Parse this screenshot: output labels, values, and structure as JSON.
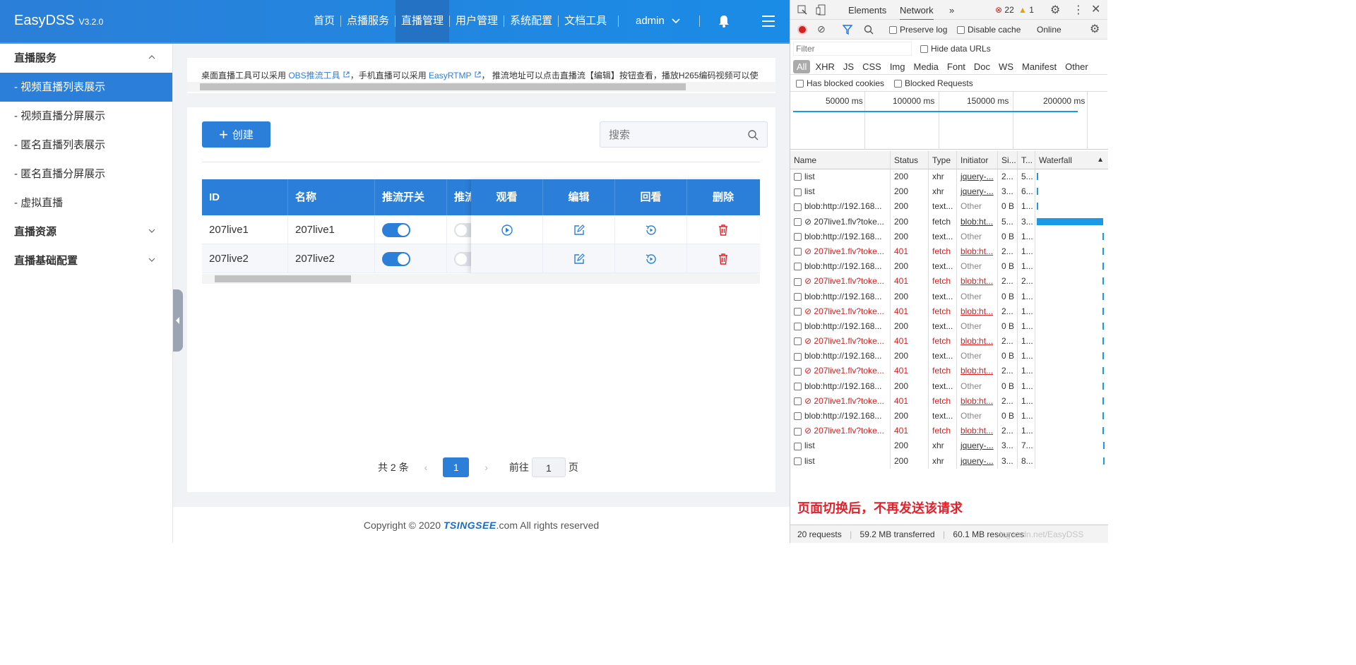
{
  "app": {
    "name": "EasyDSS",
    "version": "V3.2.0"
  },
  "nav": {
    "items": [
      "首页",
      "点播服务",
      "直播管理",
      "用户管理",
      "系统配置",
      "文档工具"
    ],
    "active": "直播管理",
    "user": "admin"
  },
  "sidebar": {
    "group1": "直播服务",
    "items": [
      "- 视频直播列表展示",
      "- 视频直播分屏展示",
      "- 匿名直播列表展示",
      "- 匿名直播分屏展示",
      "- 虚拟直播"
    ],
    "group2": "直播资源",
    "group3": "直播基础配置"
  },
  "notice": {
    "prefix": "桌面直播工具可以采用 ",
    "obs": "OBS推流工具",
    "mid": "，手机直播可以采用 ",
    "rtmp": "EasyRTMP",
    "suffix": "，  推流地址可以点击直播流【编辑】按钮查看，播放H265编码视频可以使"
  },
  "toolbar": {
    "create": "创建",
    "search_placeholder": "搜索"
  },
  "table": {
    "headers": [
      "ID",
      "名称",
      "推流开关",
      "推流",
      "观看",
      "编辑",
      "回看",
      "删除"
    ],
    "rows": [
      {
        "id": "207live1",
        "name": "207live1",
        "push": true,
        "streaming": false
      },
      {
        "id": "207live2",
        "name": "207live2",
        "push": true,
        "streaming": false
      }
    ]
  },
  "pager": {
    "total": "共 2 条",
    "current": "1",
    "goto": "前往",
    "goto_value": "1",
    "page_unit": "页"
  },
  "footer": {
    "prefix": "Copyright © 2020 ",
    "brand": "TSINGSEE",
    "suffix": ".com All rights reserved"
  },
  "devtools": {
    "tabs": [
      "Elements",
      "Network"
    ],
    "errors": "22",
    "warnings": "1",
    "preserve_log": "Preserve log",
    "disable_cache": "Disable cache",
    "online": "Online",
    "filter_placeholder": "Filter",
    "hide_data_urls": "Hide data URLs",
    "types": [
      "All",
      "XHR",
      "JS",
      "CSS",
      "Img",
      "Media",
      "Font",
      "Doc",
      "WS",
      "Manifest",
      "Other"
    ],
    "has_blocked_cookies": "Has blocked cookies",
    "blocked_requests": "Blocked Requests",
    "ticks": [
      "50000 ms",
      "100000 ms",
      "150000 ms",
      "200000 ms"
    ],
    "columns": [
      "Name",
      "Status",
      "Type",
      "Initiator",
      "Si...",
      "T...",
      "Waterfall"
    ],
    "requests": [
      {
        "name": "list",
        "status": "200",
        "type": "xhr",
        "init": "jquery-...",
        "size": "2...",
        "time": "5...",
        "err": false
      },
      {
        "name": "list",
        "status": "200",
        "type": "xhr",
        "init": "jquery-...",
        "size": "3...",
        "time": "6...",
        "err": false
      },
      {
        "name": "blob:http://192.168...",
        "status": "200",
        "type": "text...",
        "init": "Other",
        "size": "0 B",
        "time": "1...",
        "err": false
      },
      {
        "name": "⊘ 207live1.flv?toke...",
        "status": "200",
        "type": "fetch",
        "init": "blob:ht...",
        "size": "5...",
        "time": "3...",
        "err": false
      },
      {
        "name": "blob:http://192.168...",
        "status": "200",
        "type": "text...",
        "init": "Other",
        "size": "0 B",
        "time": "1...",
        "err": false
      },
      {
        "name": "⊘ 207live1.flv?toke...",
        "status": "401",
        "type": "fetch",
        "init": "blob:ht...",
        "size": "2...",
        "time": "1...",
        "err": true
      },
      {
        "name": "blob:http://192.168...",
        "status": "200",
        "type": "text...",
        "init": "Other",
        "size": "0 B",
        "time": "1...",
        "err": false
      },
      {
        "name": "⊘ 207live1.flv?toke...",
        "status": "401",
        "type": "fetch",
        "init": "blob:ht...",
        "size": "2...",
        "time": "2...",
        "err": true
      },
      {
        "name": "blob:http://192.168...",
        "status": "200",
        "type": "text...",
        "init": "Other",
        "size": "0 B",
        "time": "1...",
        "err": false
      },
      {
        "name": "⊘ 207live1.flv?toke...",
        "status": "401",
        "type": "fetch",
        "init": "blob:ht...",
        "size": "2...",
        "time": "1...",
        "err": true
      },
      {
        "name": "blob:http://192.168...",
        "status": "200",
        "type": "text...",
        "init": "Other",
        "size": "0 B",
        "time": "1...",
        "err": false
      },
      {
        "name": "⊘ 207live1.flv?toke...",
        "status": "401",
        "type": "fetch",
        "init": "blob:ht...",
        "size": "2...",
        "time": "1...",
        "err": true
      },
      {
        "name": "blob:http://192.168...",
        "status": "200",
        "type": "text...",
        "init": "Other",
        "size": "0 B",
        "time": "1...",
        "err": false
      },
      {
        "name": "⊘ 207live1.flv?toke...",
        "status": "401",
        "type": "fetch",
        "init": "blob:ht...",
        "size": "2...",
        "time": "1...",
        "err": true
      },
      {
        "name": "blob:http://192.168...",
        "status": "200",
        "type": "text...",
        "init": "Other",
        "size": "0 B",
        "time": "1...",
        "err": false
      },
      {
        "name": "⊘ 207live1.flv?toke...",
        "status": "401",
        "type": "fetch",
        "init": "blob:ht...",
        "size": "2...",
        "time": "1...",
        "err": true
      },
      {
        "name": "blob:http://192.168...",
        "status": "200",
        "type": "text...",
        "init": "Other",
        "size": "0 B",
        "time": "1...",
        "err": false
      },
      {
        "name": "⊘ 207live1.flv?toke...",
        "status": "401",
        "type": "fetch",
        "init": "blob:ht...",
        "size": "2...",
        "time": "1...",
        "err": true
      },
      {
        "name": "list",
        "status": "200",
        "type": "xhr",
        "init": "jquery-...",
        "size": "3...",
        "time": "7...",
        "err": false
      },
      {
        "name": "list",
        "status": "200",
        "type": "xhr",
        "init": "jquery-...",
        "size": "3...",
        "time": "8...",
        "err": false
      }
    ],
    "note": "页面切换后，不再发送该请求",
    "status_requests": "20 requests",
    "status_transferred": "59.2 MB transferred",
    "status_resources": "60.1 MB resources",
    "watermark": "log.csdn.net/EasyDSS"
  },
  "colors": {
    "primary": "#2b7fd8",
    "error": "#d32222",
    "delete": "#e4202a"
  }
}
